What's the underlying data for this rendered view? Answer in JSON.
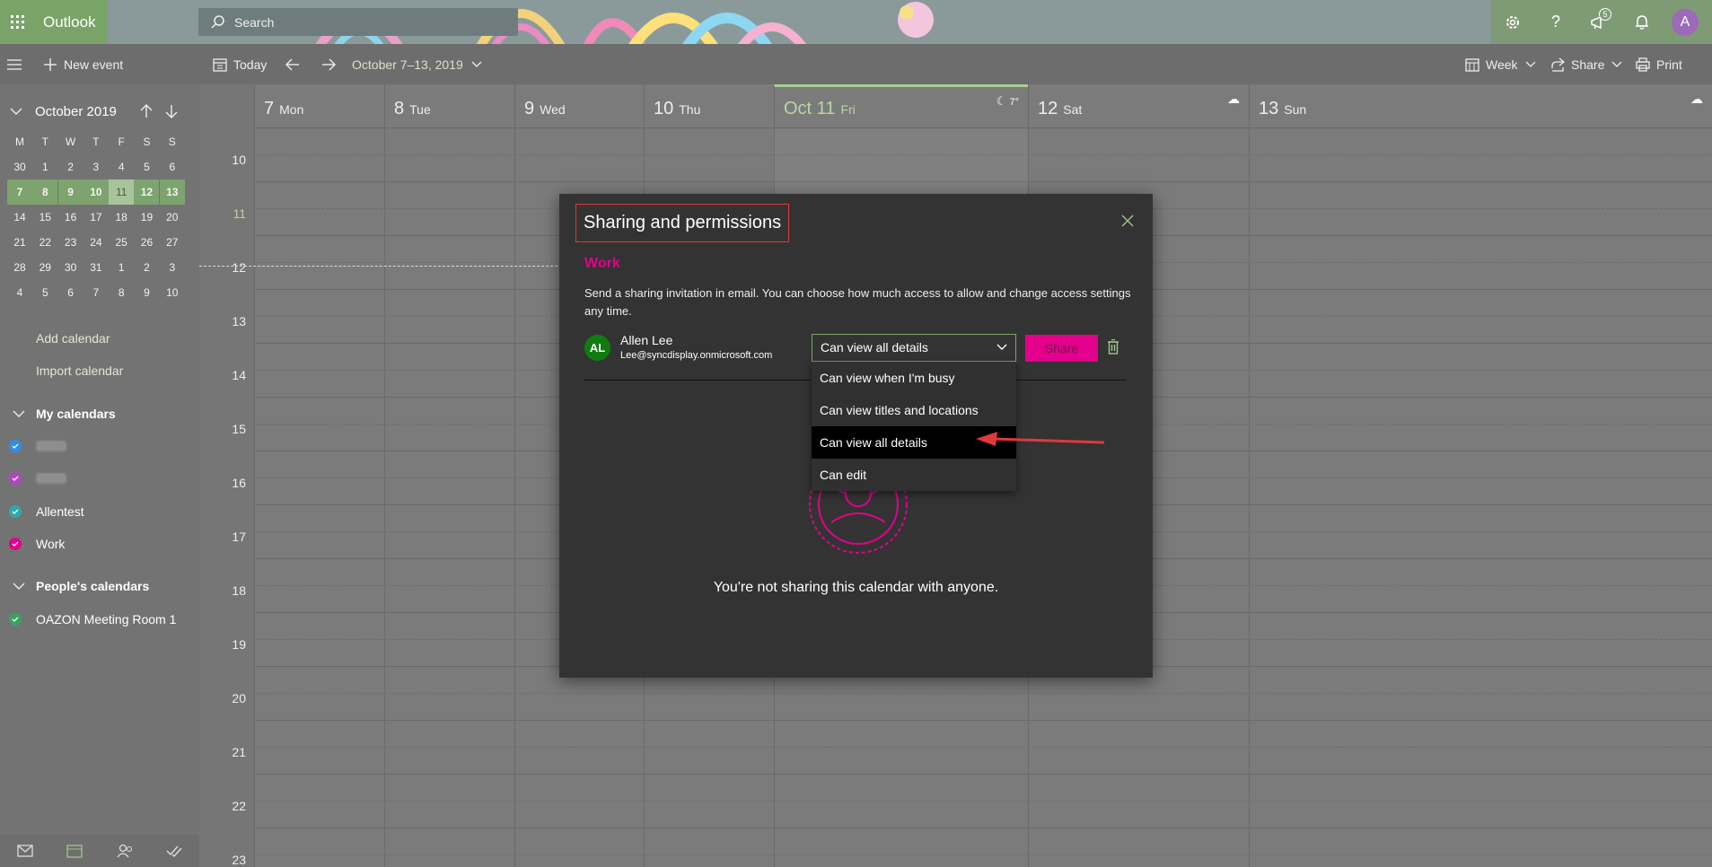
{
  "header": {
    "app_name": "Outlook",
    "search_placeholder": "Search",
    "notification_count": "5",
    "avatar_initial": "A"
  },
  "commandbar": {
    "new_event": "New event",
    "today": "Today",
    "date_range": "October 7–13, 2019",
    "view": "Week",
    "share": "Share",
    "print": "Print"
  },
  "minical": {
    "month": "October 2019",
    "weekdays": [
      "M",
      "T",
      "W",
      "T",
      "F",
      "S",
      "S"
    ],
    "rows": [
      [
        "30",
        "1",
        "2",
        "3",
        "4",
        "5",
        "6"
      ],
      [
        "7",
        "8",
        "9",
        "10",
        "11",
        "12",
        "13"
      ],
      [
        "14",
        "15",
        "16",
        "17",
        "18",
        "19",
        "20"
      ],
      [
        "21",
        "22",
        "23",
        "24",
        "25",
        "26",
        "27"
      ],
      [
        "28",
        "29",
        "30",
        "31",
        "1",
        "2",
        "3"
      ],
      [
        "4",
        "5",
        "6",
        "7",
        "8",
        "9",
        "10"
      ]
    ]
  },
  "leftnav": {
    "add_calendar": "Add calendar",
    "import_calendar": "Import calendar",
    "my_calendars": "My calendars",
    "my_calendar_items": [
      {
        "label": "",
        "color": "#2f8fe6",
        "blurred": true
      },
      {
        "label": "",
        "color": "#b146c2",
        "blurred": true
      },
      {
        "label": "Allentest",
        "color": "#2fa8a8",
        "blurred": false
      },
      {
        "label": "Work",
        "color": "#e3008c",
        "blurred": false
      }
    ],
    "peoples_calendars": "People's calendars",
    "people_items": [
      {
        "label": "OAZON Meeting Room 1",
        "color": "#3aa35a"
      }
    ]
  },
  "calendar": {
    "days": [
      {
        "num": "7",
        "name": "Mon"
      },
      {
        "num": "8",
        "name": "Tue"
      },
      {
        "num": "9",
        "name": "Wed"
      },
      {
        "num": "10",
        "name": "Thu"
      },
      {
        "num": "Oct 11",
        "name": "Fri",
        "weather": "7°"
      },
      {
        "num": "12",
        "name": "Sat"
      },
      {
        "num": "13",
        "name": "Sun"
      }
    ],
    "hours": [
      "10",
      "11",
      "12",
      "13",
      "14",
      "15",
      "16",
      "17",
      "18",
      "19",
      "20",
      "21",
      "22",
      "23"
    ]
  },
  "dialog": {
    "title": "Sharing and permissions",
    "calendar_name": "Work",
    "description": "Send a sharing invitation in email. You can choose how much access to allow and change access settings any time.",
    "person": {
      "initials": "AL",
      "name": "Allen Lee",
      "email": "Lee@syncdisplay.onmicrosoft.com"
    },
    "selected_permission": "Can view all details",
    "share_button": "Share",
    "options": [
      "Can view when I'm busy",
      "Can view titles and locations",
      "Can view all details",
      "Can edit"
    ],
    "empty_message": "You're not sharing this calendar with anyone."
  },
  "colors": {
    "accent_green": "#7da36e",
    "brand_pink": "#e3008c",
    "annotation_red": "#e0383b"
  }
}
